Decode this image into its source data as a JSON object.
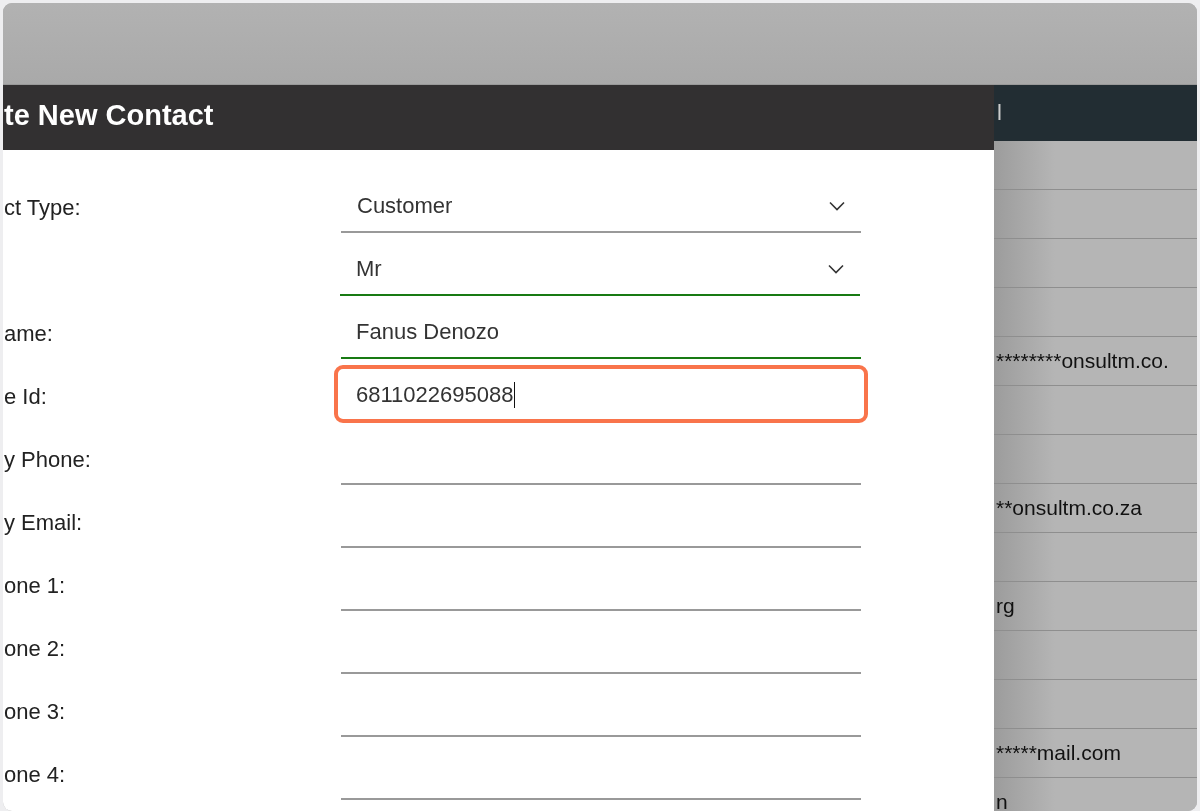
{
  "dialog": {
    "title": "te New Contact",
    "fields": [
      {
        "label": "ct Type:",
        "kind": "select",
        "value": "Customer",
        "valid": false,
        "highlighted": false,
        "caret": false
      },
      {
        "kind": "select",
        "value": "Mr",
        "valid": true,
        "highlighted": false,
        "caret": false
      },
      {
        "label": "ame:",
        "kind": "text",
        "value": "Fanus Denozo",
        "valid": true,
        "highlighted": false,
        "caret": false
      },
      {
        "label": "e Id:",
        "kind": "text",
        "value": "6811022695088",
        "valid": false,
        "highlighted": true,
        "caret": true
      },
      {
        "label": "y Phone:",
        "kind": "text",
        "valid": false,
        "highlighted": false,
        "caret": false
      },
      {
        "label": "y Email:",
        "kind": "text",
        "valid": false,
        "highlighted": false,
        "caret": false
      },
      {
        "label": "one 1:",
        "kind": "text",
        "valid": false,
        "highlighted": false,
        "caret": false
      },
      {
        "label": "one 2:",
        "kind": "text",
        "valid": false,
        "highlighted": false,
        "caret": false
      },
      {
        "label": "one 3:",
        "kind": "text",
        "valid": false,
        "highlighted": false,
        "caret": false
      },
      {
        "label": "one 4:",
        "kind": "text",
        "valid": false,
        "highlighted": false,
        "caret": false
      }
    ]
  },
  "table": {
    "header": "l",
    "rows": [
      {},
      {},
      {},
      {},
      {
        "cell": "********onsultm.co."
      },
      {},
      {},
      {
        "cell": "**onsultm.co.za"
      },
      {},
      {
        "cell": "rg"
      },
      {},
      {},
      {
        "cell": "*****mail.com"
      },
      {
        "cell": "n"
      }
    ]
  }
}
